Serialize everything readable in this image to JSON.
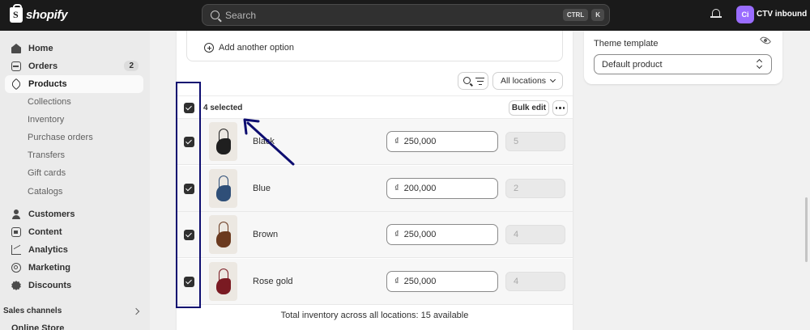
{
  "topbar": {
    "logo_text": "shopify",
    "search_placeholder": "Search",
    "shortcut_key1": "CTRL",
    "shortcut_key2": "K",
    "avatar_initials": "Ci",
    "store_name": "CTV inbound"
  },
  "sidebar": {
    "home": "Home",
    "orders": "Orders",
    "orders_badge": "2",
    "products": "Products",
    "sub": [
      "Collections",
      "Inventory",
      "Purchase orders",
      "Transfers",
      "Gift cards",
      "Catalogs"
    ],
    "customers": "Customers",
    "content": "Content",
    "analytics": "Analytics",
    "marketing": "Marketing",
    "discounts": "Discounts",
    "sales_channels": "Sales channels",
    "online_store": "Online Store"
  },
  "variants_card": {
    "add_option": "Add another option",
    "location_filter": "All locations",
    "selected_text": "4 selected",
    "bulk_edit": "Bulk edit",
    "currency_symbol": "₫",
    "rows": [
      {
        "name": "Black",
        "price": "250,000",
        "qty": "5",
        "bag_color": "#1f1f1f"
      },
      {
        "name": "Blue",
        "price": "200,000",
        "qty": "2",
        "bag_color": "#2f4f78"
      },
      {
        "name": "Brown",
        "price": "250,000",
        "qty": "4",
        "bag_color": "#6b3a1f"
      },
      {
        "name": "Rose gold",
        "price": "250,000",
        "qty": "4",
        "bag_color": "#7a1a22"
      }
    ],
    "total_text": "Total inventory across all locations: 15 available"
  },
  "theme_card": {
    "label": "Theme template",
    "selected": "Default product"
  },
  "colors": {
    "annotation": "#0d0d70",
    "topbar": "#1a1a1a"
  }
}
